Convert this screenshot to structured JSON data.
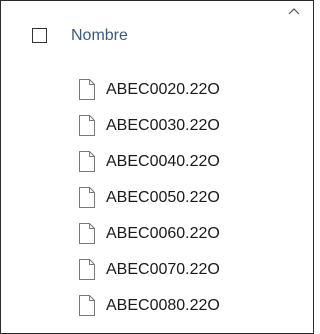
{
  "header": {
    "column_name": "Nombre",
    "sort_icon": "chevron-up-icon",
    "select_all_checked": false
  },
  "files": [
    {
      "name": "ABEC0020.22O",
      "icon": "file-icon"
    },
    {
      "name": "ABEC0030.22O",
      "icon": "file-icon"
    },
    {
      "name": "ABEC0040.22O",
      "icon": "file-icon"
    },
    {
      "name": "ABEC0050.22O",
      "icon": "file-icon"
    },
    {
      "name": "ABEC0060.22O",
      "icon": "file-icon"
    },
    {
      "name": "ABEC0070.22O",
      "icon": "file-icon"
    },
    {
      "name": "ABEC0080.22O",
      "icon": "file-icon"
    }
  ],
  "colors": {
    "header_text": "#3d5a80",
    "file_text": "#1a1a1a",
    "border": "#2b2b2b"
  }
}
